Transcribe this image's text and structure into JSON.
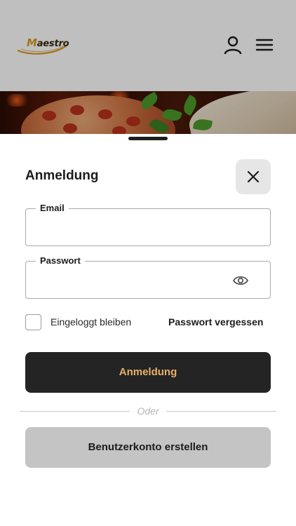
{
  "header": {
    "logo_text": "Maestro",
    "logo_initial": "M",
    "logo_rest": "aestro",
    "user_icon": "user-icon",
    "menu_icon": "hamburger-menu-icon"
  },
  "login_sheet": {
    "title": "Anmeldung",
    "close_icon": "close-icon",
    "email": {
      "label": "Email",
      "value": "",
      "placeholder": ""
    },
    "password": {
      "label": "Passwort",
      "value": "",
      "placeholder": "",
      "toggle_icon": "eye-icon"
    },
    "remember_label": "Eingeloggt bleiben",
    "remember_checked": false,
    "forgot_label": "Passwort vergessen",
    "submit_label": "Anmeldung",
    "divider_label": "Oder",
    "register_label": "Benutzerkonto erstellen"
  },
  "colors": {
    "accent": "#e9b169",
    "primary_button": "#242424",
    "secondary_button": "#c4c4c4",
    "logo_gold": "#d89a1c"
  }
}
